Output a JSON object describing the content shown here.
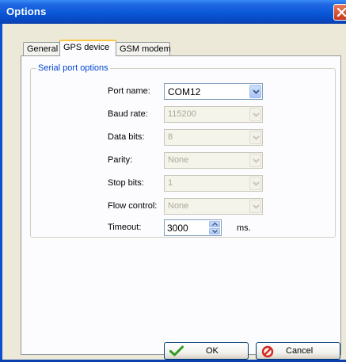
{
  "window": {
    "title": "Options"
  },
  "tabs": [
    {
      "label": "General",
      "active": false
    },
    {
      "label": "GPS device",
      "active": true
    },
    {
      "label": "GSM modem",
      "active": false
    }
  ],
  "serial_port": {
    "group_label": "Serial port options",
    "fields": {
      "port_name": {
        "label": "Port name:",
        "value": "COM12",
        "enabled": true
      },
      "baud_rate": {
        "label": "Baud rate:",
        "value": "115200",
        "enabled": false
      },
      "data_bits": {
        "label": "Data bits:",
        "value": "8",
        "enabled": false
      },
      "parity": {
        "label": "Parity:",
        "value": "None",
        "enabled": false
      },
      "stop_bits": {
        "label": "Stop bits:",
        "value": "1",
        "enabled": false
      },
      "flow_control": {
        "label": "Flow control:",
        "value": "None",
        "enabled": false
      },
      "timeout": {
        "label": "Timeout:",
        "value": "3000",
        "unit": "ms."
      }
    }
  },
  "buttons": {
    "ok": {
      "label": "OK",
      "icon": "checkmark-icon"
    },
    "cancel": {
      "label": "Cancel",
      "icon": "cancel-icon"
    }
  },
  "colors": {
    "titlebar": "#0a58d9",
    "dialog_bg": "#ece9d8",
    "group_label": "#0046d5",
    "tab_highlight": "#ffc83c"
  }
}
